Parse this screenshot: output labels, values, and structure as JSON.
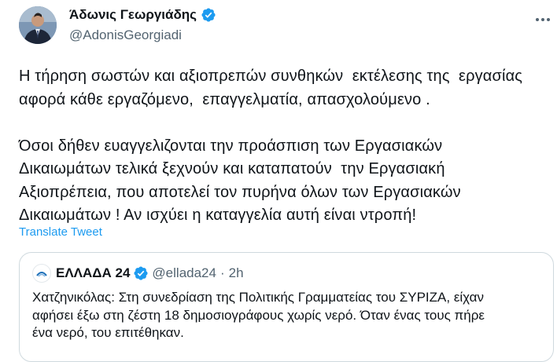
{
  "author": {
    "display_name": "Άδωνις Γεωργιάδης",
    "handle": "@AdonisGeorgiadi"
  },
  "tweet": {
    "lines": [
      "Η τήρηση σωστών και αξιοπρεπών συνθηκών  εκτέλεσης της  εργασίας",
      "αφορά κάθε εργαζόμενο,  επαγγελματία, απασχολούμενο .",
      "",
      "Όσοι δήθεν ευαγγελιζονται την προάσπιση των Εργασιακών",
      "Δικαιωμάτων τελικά ξεχνούν και καταπατούν  την Εργασιακή",
      "Αξιοπρέπεια, που αποτελεί τον πυρήνα όλων των Εργασιακών",
      "Δικαιωμάτων ! Αν ισχύει η καταγγελία αυτή είναι ντροπή!"
    ],
    "translate_label": "Translate Tweet"
  },
  "quote": {
    "display_name": "ΕΛΛΑΔΑ 24",
    "handle": "@ellada24",
    "separator": "·",
    "time": "2h",
    "lines": [
      "Χατζηνικόλας: Στη συνεδρίαση της Πολιτικής Γραμματείας του ΣΥΡΙΖΑ, είχαν",
      "αφήσει έξω στη ζέστη 18 δημοσιογράφους χωρίς νερό. Όταν ένας τους πήρε",
      "ένα νερό, του επιτέθηκαν."
    ]
  },
  "icons": {
    "verified": "verified-badge-icon",
    "more": "more-options-icon"
  },
  "colors": {
    "verified": "#1d9bf0",
    "link": "#1d9bf0",
    "text": "#0f1419",
    "secondary": "#536471",
    "border": "#cfd9de"
  }
}
